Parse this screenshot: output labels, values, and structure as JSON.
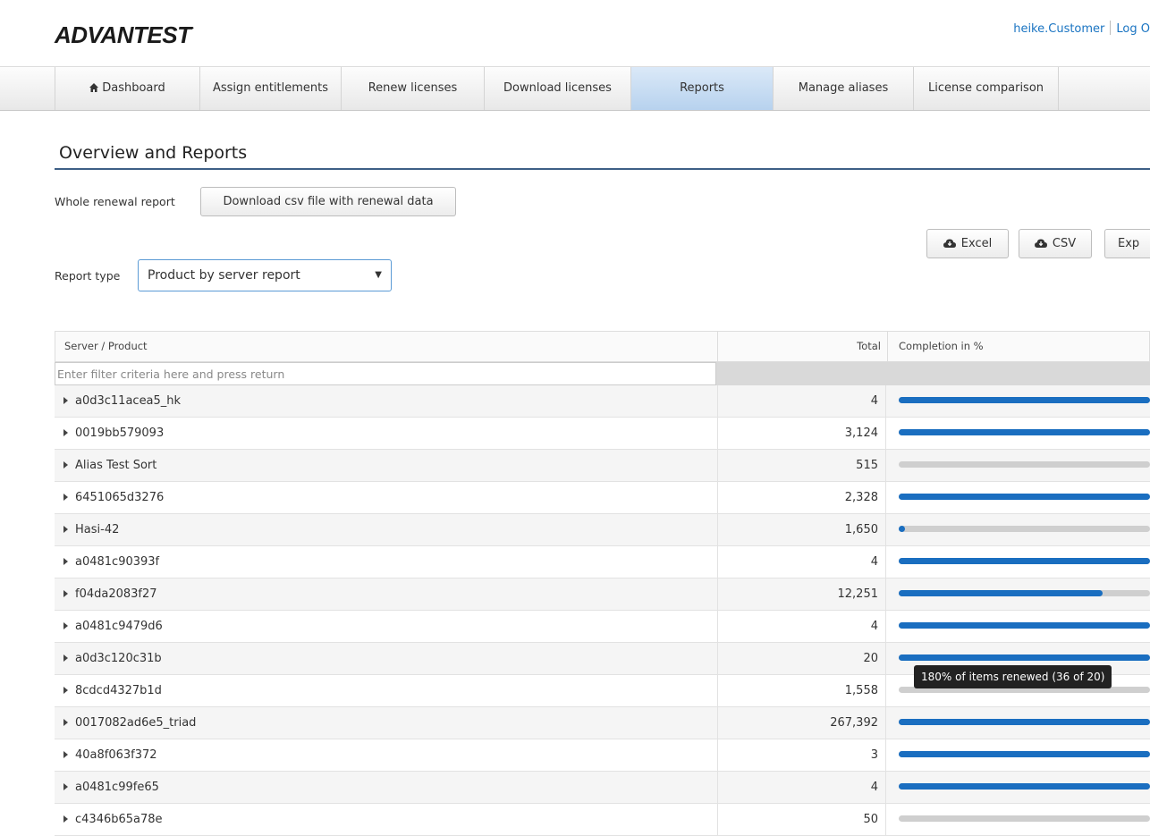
{
  "header": {
    "logo_text": "ADVANTEST",
    "logo_mark": ".",
    "username": "heike.Customer",
    "logout": "Log O"
  },
  "nav": {
    "tabs": [
      {
        "label": "Dashboard",
        "icon": "home-icon"
      },
      {
        "label": "Assign entitlements"
      },
      {
        "label": "Renew licenses"
      },
      {
        "label": "Download licenses"
      },
      {
        "label": "Reports",
        "active": true
      },
      {
        "label": "Manage aliases"
      },
      {
        "label": "License comparison"
      }
    ]
  },
  "page": {
    "title": "Overview and Reports",
    "renewal_label": "Whole renewal report",
    "download_button": "Download csv file with renewal data",
    "export_buttons": [
      {
        "label": "Excel",
        "icon": "cloud-download-icon"
      },
      {
        "label": "CSV",
        "icon": "cloud-download-icon"
      },
      {
        "label": "Exp"
      }
    ],
    "report_type_label": "Report type",
    "report_type_value": "Product by server report"
  },
  "table": {
    "columns": [
      "Server / Product",
      "Total",
      "Completion in %"
    ],
    "filter_placeholder": "Enter filter criteria here and press return",
    "rows": [
      {
        "name": "a0d3c11acea5_hk",
        "total": "4",
        "completion": 1.0
      },
      {
        "name": "0019bb579093",
        "total": "3,124",
        "completion": 1.0
      },
      {
        "name": "Alias Test Sort",
        "total": "515",
        "completion": 0.0
      },
      {
        "name": "6451065d3276",
        "total": "2,328",
        "completion": 1.0
      },
      {
        "name": "Hasi-42",
        "total": "1,650",
        "completion": 0.02
      },
      {
        "name": "a0481c90393f",
        "total": "4",
        "completion": 1.0
      },
      {
        "name": "f04da2083f27",
        "total": "12,251",
        "completion": 0.81
      },
      {
        "name": "a0481c9479d6",
        "total": "4",
        "completion": 1.0
      },
      {
        "name": "a0d3c120c31b",
        "total": "20",
        "completion": 1.0
      },
      {
        "name": "8cdcd4327b1d",
        "total": "1,558",
        "completion": 0.0
      },
      {
        "name": "0017082ad6e5_triad",
        "total": "267,392",
        "completion": 1.0
      },
      {
        "name": "40a8f063f372",
        "total": "3",
        "completion": 1.0
      },
      {
        "name": "a0481c99fe65",
        "total": "4",
        "completion": 1.0
      },
      {
        "name": "c4346b65a78e",
        "total": "50",
        "completion": 0.0
      }
    ]
  },
  "tooltip": {
    "text": "180% of items renewed (36 of 20)"
  }
}
